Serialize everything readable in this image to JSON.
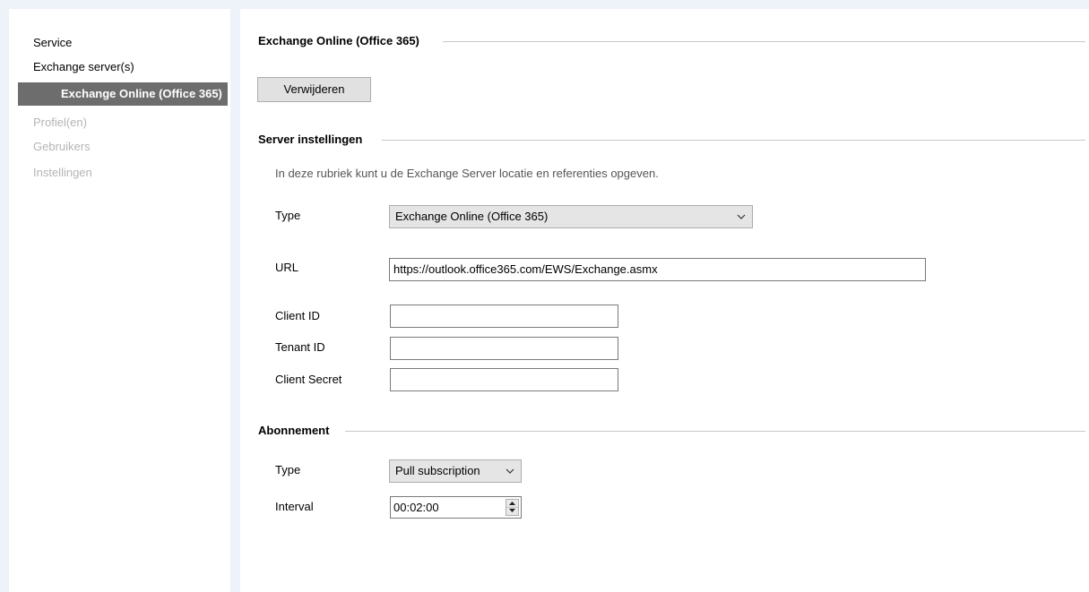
{
  "sidebar": {
    "items": [
      {
        "label": "Service",
        "state": "normal"
      },
      {
        "label": "Exchange server(s)",
        "state": "normal"
      },
      {
        "label": "Exchange Online (Office 365)",
        "state": "selected"
      },
      {
        "label": "Profiel(en)",
        "state": "disabled"
      },
      {
        "label": "Gebruikers",
        "state": "disabled"
      },
      {
        "label": "Instellingen",
        "state": "disabled"
      }
    ]
  },
  "main": {
    "title": "Exchange Online (Office 365)",
    "remove_button": "Verwijderen",
    "server_section": {
      "heading": "Server instellingen",
      "description": "In deze rubriek kunt u de Exchange Server locatie en referenties opgeven.",
      "type_label": "Type",
      "type_value": "Exchange Online (Office 365)",
      "url_label": "URL",
      "url_value": "https://outlook.office365.com/EWS/Exchange.asmx",
      "client_id_label": "Client ID",
      "client_id_value": "",
      "tenant_id_label": "Tenant ID",
      "tenant_id_value": "",
      "client_secret_label": "Client Secret",
      "client_secret_value": ""
    },
    "subscription_section": {
      "heading": "Abonnement",
      "type_label": "Type",
      "type_value": "Pull subscription",
      "interval_label": "Interval",
      "interval_value": "00:02:00"
    }
  },
  "colors": {
    "selected_bg": "#6d6d6d",
    "disabled_text": "#b4b4b4",
    "panel_bg": "#eef2f9"
  },
  "icons": [
    "chevron-down-icon",
    "spin-up-icon",
    "spin-down-icon"
  ]
}
